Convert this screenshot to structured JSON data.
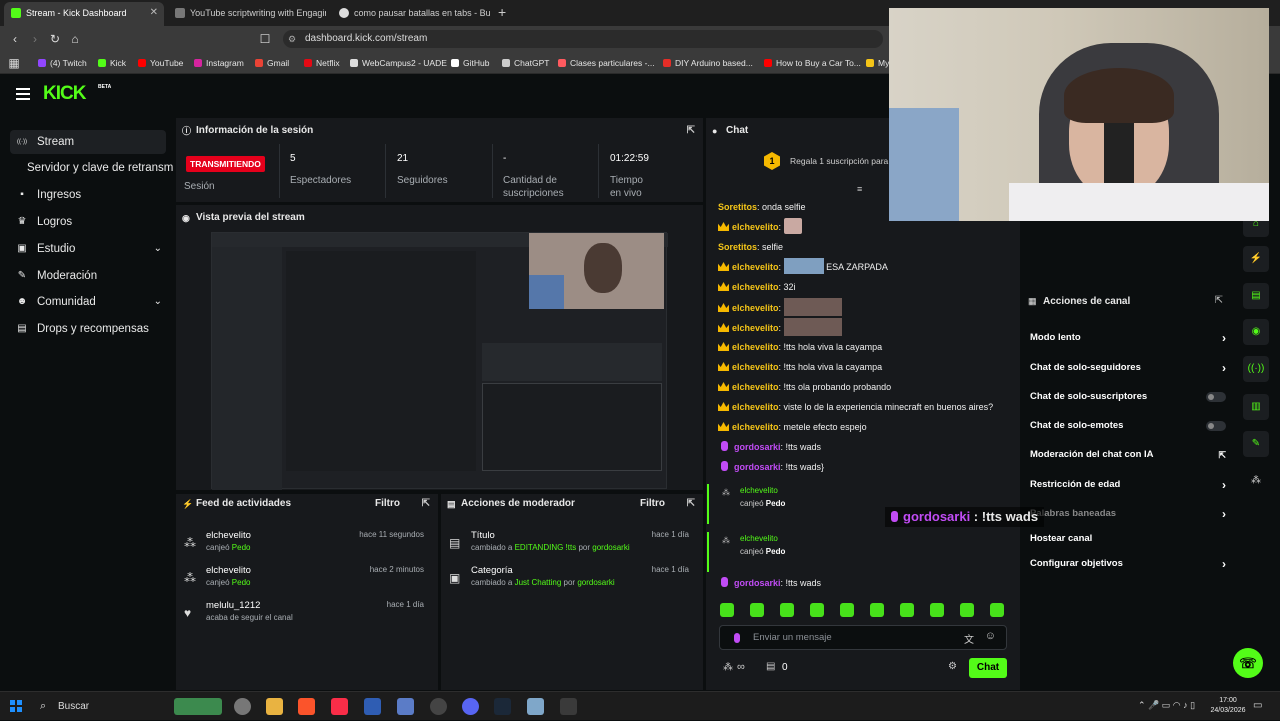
{
  "browser": {
    "tabs": [
      {
        "title": "Stream - Kick Dashboard",
        "color": "#53fc18"
      },
      {
        "title": "YouTube scriptwriting with Engaging",
        "color": "#777777"
      },
      {
        "title": "como pausar batallas en tabs - Busca",
        "color": "#dddddd"
      }
    ],
    "new_tab": "+",
    "url": "dashboard.kick.com/stream",
    "bookmarks": [
      {
        "label": "(4) Twitch",
        "color": "#9146ff"
      },
      {
        "label": "Kick",
        "color": "#53fc18"
      },
      {
        "label": "YouTube",
        "color": "#ff0000"
      },
      {
        "label": "Instagram",
        "color": "#d6249f"
      },
      {
        "label": "Gmail",
        "color": "#ea4335"
      },
      {
        "label": "Netflix",
        "color": "#e50914"
      },
      {
        "label": "WebCampus2 - UADE",
        "color": "#dddddd"
      },
      {
        "label": "GitHub",
        "color": "#ffffff"
      },
      {
        "label": "ChatGPT",
        "color": "#cccccc"
      },
      {
        "label": "Clases particulares -...",
        "color": "#ff5a5f"
      },
      {
        "label": "DIY Arduino based...",
        "color": "#e52d27"
      },
      {
        "label": "How to Buy a Car To...",
        "color": "#ff0000"
      },
      {
        "label": "My",
        "color": "#f5c518"
      }
    ]
  },
  "kick": {
    "logo": "KICK",
    "logo_badge": "BETA",
    "sidebar": [
      {
        "label": "Stream",
        "icon": "broadcast-icon"
      },
      {
        "label": "Servidor y clave de retransmisión",
        "icon": ""
      },
      {
        "label": "Ingresos",
        "icon": "money-icon"
      },
      {
        "label": "Logros",
        "icon": "trophy-icon"
      },
      {
        "label": "Estudio",
        "icon": "studio-icon",
        "chevron": "⌄"
      },
      {
        "label": "Moderación",
        "icon": "wrench-icon"
      },
      {
        "label": "Comunidad",
        "icon": "users-icon",
        "chevron": "⌄"
      },
      {
        "label": "Drops y recompensas",
        "icon": "gift-icon"
      }
    ],
    "session": {
      "title": "Información de la sesión",
      "live_badge": "TRANSMITIENDO",
      "session_label": "Sesión",
      "stats": [
        {
          "value": "5",
          "label": "Espectadores"
        },
        {
          "value": "21",
          "label": "Seguidores"
        },
        {
          "value": "-",
          "label": "Cantidad de suscripciones"
        },
        {
          "value": "01:22:59",
          "label": "Tiempo en vivo"
        }
      ]
    },
    "preview": {
      "title": "Vista previa del stream"
    },
    "activity_feed": {
      "title": "Feed de actividades",
      "filter": "Filtro",
      "items": [
        {
          "name": "elchevelito",
          "desc_prefix": "canjeó ",
          "desc_highlight": "Pedo",
          "time": "hace 11 segundos"
        },
        {
          "name": "elchevelito",
          "desc_prefix": "canjeó ",
          "desc_highlight": "Pedo",
          "time": "hace 2 minutos"
        },
        {
          "name": "melulu_1212",
          "desc_prefix": "acaba de seguir el canal",
          "desc_highlight": "",
          "time": "hace 1 día"
        }
      ]
    },
    "mod_actions": {
      "title": "Acciones de moderador",
      "filter": "Filtro",
      "items": [
        {
          "name": "Título",
          "desc_a": "cambiado a ",
          "value": "EDITANDING !tts",
          "desc_b": " por ",
          "by": "gordosarki",
          "time": "hace 1 día"
        },
        {
          "name": "Categoría",
          "desc_a": "cambiado a ",
          "value": "Just Chatting",
          "desc_b": " por ",
          "by": "gordosarki",
          "time": "hace 1 día"
        }
      ]
    },
    "chat": {
      "title": "Chat",
      "sub_count": "1",
      "sub_text": "Regala 1 suscripción para",
      "messages": [
        {
          "user": "Soretitos",
          "type": "plain",
          "text": ": onda selfie"
        },
        {
          "user": "elchevelito",
          "type": "badge",
          "text": ":",
          "emote": "small"
        },
        {
          "user": "Soretitos",
          "type": "plain",
          "text": ": selfie"
        },
        {
          "user": "elchevelito",
          "type": "badge",
          "text": ":",
          "emote": "wide",
          "after": "ESA ZARPADA"
        },
        {
          "user": "elchevelito",
          "type": "badge",
          "text": ": 32i"
        },
        {
          "user": "elchevelito",
          "type": "badge",
          "text": ":",
          "emote": "big"
        },
        {
          "user": "elchevelito",
          "type": "badge",
          "text": ":",
          "emote": "big"
        },
        {
          "user": "elchevelito",
          "type": "badge",
          "text": ": !tts hola viva la cayampa"
        },
        {
          "user": "elchevelito",
          "type": "badge",
          "text": ": !tts hola viva la cayampa"
        },
        {
          "user": "elchevelito",
          "type": "badge",
          "text": ": !tts ola probando probando"
        },
        {
          "user": "elchevelito",
          "type": "badge",
          "text": ": viste lo de la experiencia minecraft en buenos aires?"
        },
        {
          "user": "elchevelito",
          "type": "badge",
          "text": ": metele efecto espejo"
        },
        {
          "user": "gordosarki",
          "type": "mic",
          "text": ": !tts wads"
        },
        {
          "user": "gordosarki",
          "type": "mic",
          "text": ": !tts wads}"
        }
      ],
      "redeems": [
        {
          "user": "elchevelito",
          "text": "canjeó ",
          "item": "Pedo"
        },
        {
          "user": "elchevelito",
          "text": "canjeó ",
          "item": "Pedo"
        }
      ],
      "last_message": {
        "user": "gordosarki",
        "text": ": !tts wads"
      },
      "overlay_user": "gordosarki",
      "overlay_text": " : !tts wads",
      "input_placeholder": "Enviar un mensaje",
      "points": "∞",
      "gifts": "0",
      "send_label": "Chat"
    },
    "channel_actions": {
      "title": "Acciones de canal",
      "items": [
        {
          "label": "Modo lento",
          "control": "arrow"
        },
        {
          "label": "Chat de solo-seguidores",
          "control": "arrow"
        },
        {
          "label": "Chat de solo-suscriptores",
          "control": "toggle"
        },
        {
          "label": "Chat de solo-emotes",
          "control": "toggle"
        },
        {
          "label": "Moderación del chat con IA",
          "control": "external"
        },
        {
          "label": "Restricción de edad",
          "control": "arrow"
        },
        {
          "label": "Palabras baneadas",
          "control": "arrow"
        },
        {
          "label": "Hostear canal",
          "control": "none"
        },
        {
          "label": "Configurar objetivos",
          "control": "arrow"
        }
      ]
    }
  },
  "taskbar": {
    "search": "Buscar",
    "time": "17:00",
    "date": "24/03/2026"
  }
}
